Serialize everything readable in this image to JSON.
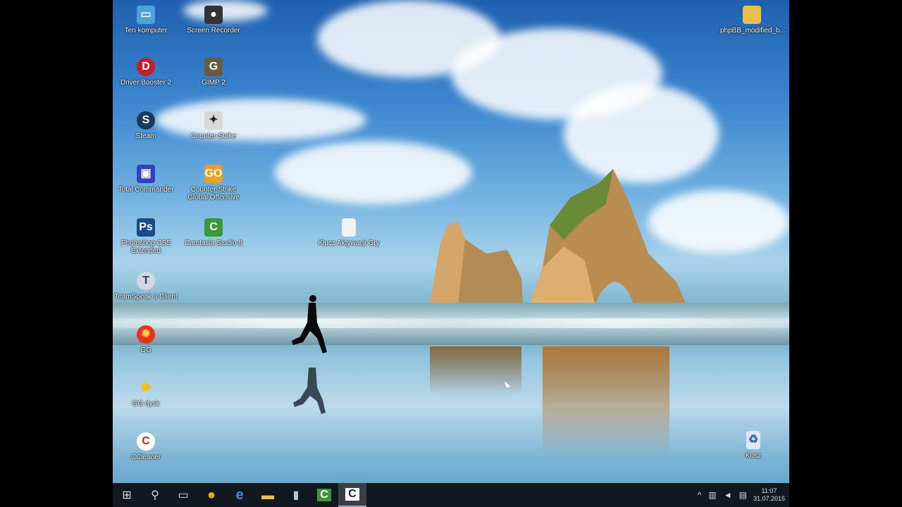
{
  "desktop": {
    "icons": [
      {
        "label": "Ten komputer",
        "icon": "computer-icon",
        "color": "#4aa3df"
      },
      {
        "label": "Screen Recorder",
        "icon": "recorder-icon",
        "color": "#333333"
      },
      {
        "label": "phpBB_modified_b...",
        "icon": "folder-icon",
        "color": "#e8c050"
      },
      {
        "label": "Driver Booster 2",
        "icon": "driver-booster-icon",
        "color": "#c0202a"
      },
      {
        "label": "GIMP 2",
        "icon": "gimp-icon",
        "color": "#6b5a40"
      },
      {
        "label": "Steam",
        "icon": "steam-icon",
        "color": "#1b3a5c"
      },
      {
        "label": "Counter-Strike",
        "icon": "counter-strike-icon",
        "color": "#d8d8d8"
      },
      {
        "label": "Total Commander",
        "icon": "total-commander-icon",
        "color": "#3040c0"
      },
      {
        "label": "Counter-Strike Global Offensive",
        "icon": "csgo-icon",
        "color": "#e8a020"
      },
      {
        "label": "Photoshop CS5 Extended",
        "icon": "photoshop-icon",
        "color": "#1a4a8a"
      },
      {
        "label": "Camtasia Studio 8",
        "icon": "camtasia-icon",
        "color": "#3a9a3a"
      },
      {
        "label": "Klucz Aktywacji Gry",
        "icon": "document-icon",
        "color": "#f0f0f0"
      },
      {
        "label": "TeamSpeak 3 Client",
        "icon": "teamspeak-icon",
        "color": "#cfd8e0"
      },
      {
        "label": "GG",
        "icon": "gg-icon",
        "color": "#e83020"
      },
      {
        "label": "GG dysk",
        "icon": "gg-dysk-icon",
        "color": "#f0c020"
      },
      {
        "label": "CCleaner",
        "icon": "ccleaner-icon",
        "color": "#d02020"
      },
      {
        "label": "Kosz",
        "icon": "recycle-bin-icon",
        "color": "#dfe8f0"
      }
    ]
  },
  "taskbar": {
    "start_label": "⊞",
    "search_label": "⚲",
    "task_view_label": "▭",
    "apps": [
      {
        "name": "chrome",
        "glyph": "●",
        "color": "#e8b020"
      },
      {
        "name": "edge",
        "glyph": "e",
        "color": "#3a8fe0"
      },
      {
        "name": "file-explorer",
        "glyph": "▬",
        "color": "#e8c050"
      },
      {
        "name": "app4",
        "glyph": "▮",
        "color": "#b0c8d8"
      },
      {
        "name": "camtasia",
        "glyph": "C",
        "color": "#3a9a3a"
      },
      {
        "name": "camtasia-recorder",
        "glyph": "C",
        "color": "#ffffff"
      }
    ],
    "tray": {
      "chevron": "^",
      "network": "▥",
      "volume": "◄",
      "notifications": "▤",
      "time": "11:07",
      "date": "31.07.2015"
    }
  }
}
